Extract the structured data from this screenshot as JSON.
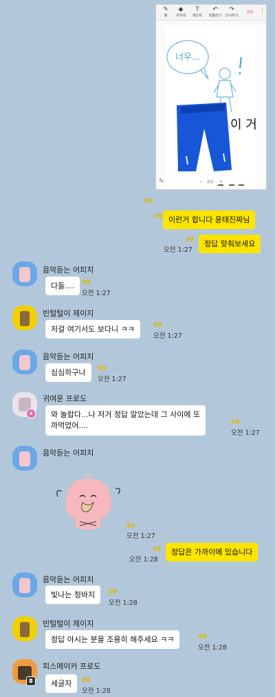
{
  "image_card": {
    "toolbar": [
      "펜",
      "지우개",
      "텍스트",
      "되돌리기",
      "다시하기"
    ],
    "toolbar_action": "저장",
    "pager": "2/2",
    "drawing": {
      "speech": "너우...",
      "side_text": "이 거"
    }
  },
  "read_mark": "99",
  "messages": [
    {
      "text": "이런거 합니다 윤태진짜님"
    },
    {
      "text": "정답 맞춰보세요",
      "time": "오전 1:27"
    },
    {
      "sender": "음악듣는 어피치",
      "text": "다들....",
      "time": "오전 1:27"
    },
    {
      "sender": "빈털털이 제이지",
      "text": "저걸 여기서도 보다니 ㅋㅋ",
      "time": "오전 1:27"
    },
    {
      "sender": "음악듣는 어피치",
      "text": "심심하구나",
      "time": "오전 1:27"
    },
    {
      "sender": "귀여운 프로도",
      "text_line1": "와 놀랍다...나 저거 정답 알았는데 그 사이에 또",
      "text_line2": "까먹었어....",
      "time": "오전 1:27"
    },
    {
      "sender": "음악듣는 어피치",
      "sticker": "apeach-sticker",
      "time": "오전 1:27"
    },
    {
      "text": "정답은 가까이에 있습니다",
      "time": "오전 1:28"
    },
    {
      "sender": "음악듣는 어피치",
      "text": "빛나는 청바지",
      "time": "오전 1:28"
    },
    {
      "sender": "빈털털이 제이지",
      "text": "정답 아시는 분을 조용히 해주세요 ㅋㅋ",
      "time": "오전 1:28"
    },
    {
      "sender": "피스메이커 프로도",
      "text": "세글자",
      "time": "오전 1:28"
    }
  ]
}
